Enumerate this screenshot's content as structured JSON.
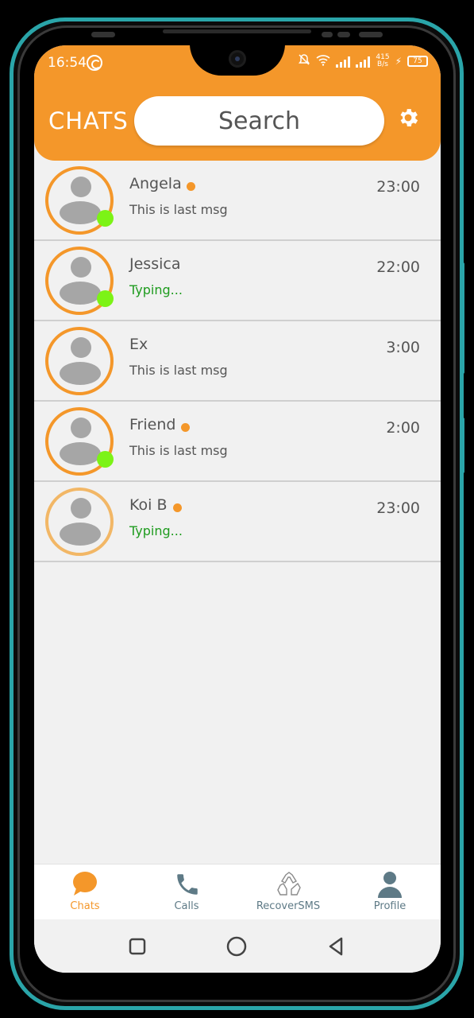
{
  "status_bar": {
    "time": "16:54",
    "net_speed_top": "415",
    "net_speed_bottom": "B/s",
    "battery": "75"
  },
  "header": {
    "title": "CHATS",
    "search_placeholder": "Search"
  },
  "chats": [
    {
      "name": "Angela",
      "last_message": "This is last msg",
      "time": "23:00",
      "typing": false,
      "online": true,
      "unread": true
    },
    {
      "name": "Jessica",
      "last_message": "Typing...",
      "time": "22:00",
      "typing": true,
      "online": true,
      "unread": false
    },
    {
      "name": "Ex",
      "last_message": "This is last msg",
      "time": "3:00",
      "typing": false,
      "online": false,
      "unread": false
    },
    {
      "name": "Friend",
      "last_message": "This is last msg",
      "time": "2:00",
      "typing": false,
      "online": true,
      "unread": true
    },
    {
      "name": "Koi B",
      "last_message": "Typing...",
      "time": "23:00",
      "typing": true,
      "online": false,
      "unread": true
    }
  ],
  "bottom_nav": [
    {
      "label": "Chats",
      "icon": "chat-bubble-icon",
      "active": true
    },
    {
      "label": "Calls",
      "icon": "phone-icon",
      "active": false
    },
    {
      "label": "RecoverSMS",
      "icon": "recycle-icon",
      "active": false
    },
    {
      "label": "Profile",
      "icon": "person-icon",
      "active": false
    }
  ],
  "colors": {
    "accent": "#f4972a",
    "online": "#7cf316",
    "typing": "#1e9b1e",
    "nav_inactive": "#5e7a86"
  }
}
